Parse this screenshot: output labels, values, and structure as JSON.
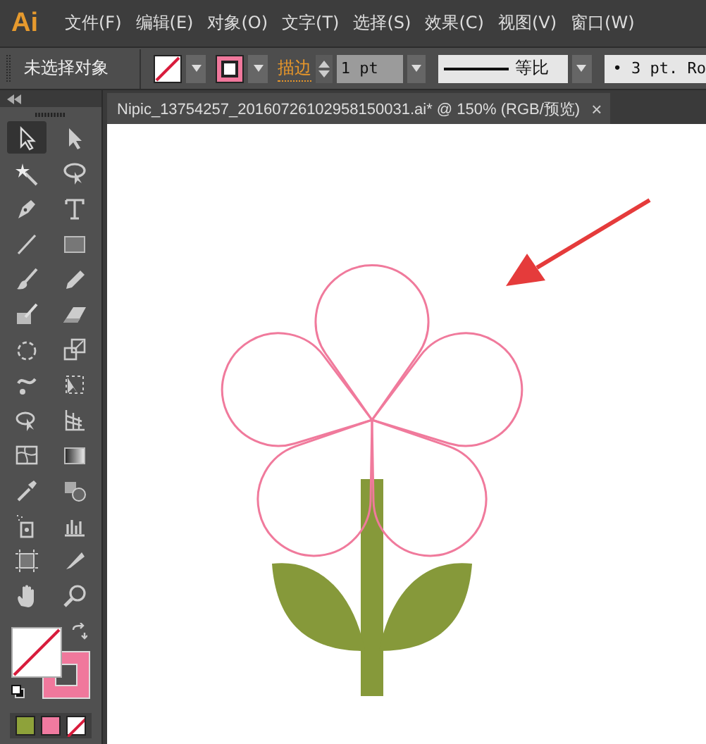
{
  "app_logo": "Ai",
  "menu": [
    "文件(F)",
    "编辑(E)",
    "对象(O)",
    "文字(T)",
    "选择(S)",
    "效果(C)",
    "视图(V)",
    "窗口(W)"
  ],
  "control_bar": {
    "selection_status": "未选择对象",
    "stroke_label": "描边",
    "stroke_weight": "1 pt",
    "profile": "等比",
    "brush": "•  3 pt. Ro"
  },
  "document_tab": {
    "title": "Nipic_13754257_20160726102958150031.ai*  @  150%  (RGB/预览)",
    "close": "×"
  },
  "tools": [
    {
      "kind": "selection",
      "selected": true
    },
    {
      "kind": "direct-selection",
      "selected": false
    },
    {
      "kind": "magic-wand",
      "selected": false
    },
    {
      "kind": "lasso",
      "selected": false
    },
    {
      "kind": "pen",
      "selected": false
    },
    {
      "kind": "type",
      "selected": false
    },
    {
      "kind": "line",
      "selected": false
    },
    {
      "kind": "rectangle",
      "selected": false
    },
    {
      "kind": "paintbrush",
      "selected": false
    },
    {
      "kind": "pencil",
      "selected": false
    },
    {
      "kind": "blob-brush",
      "selected": false
    },
    {
      "kind": "eraser",
      "selected": false
    },
    {
      "kind": "rotate",
      "selected": false
    },
    {
      "kind": "scale",
      "selected": false
    },
    {
      "kind": "warp",
      "selected": false
    },
    {
      "kind": "free-transform",
      "selected": false
    },
    {
      "kind": "shape-builder",
      "selected": false
    },
    {
      "kind": "perspective-grid",
      "selected": false
    },
    {
      "kind": "mesh",
      "selected": false
    },
    {
      "kind": "gradient",
      "selected": false
    },
    {
      "kind": "eyedropper",
      "selected": false
    },
    {
      "kind": "blend",
      "selected": false
    },
    {
      "kind": "symbol-sprayer",
      "selected": false
    },
    {
      "kind": "column-graph",
      "selected": false
    },
    {
      "kind": "artboard",
      "selected": false
    },
    {
      "kind": "slice",
      "selected": false
    },
    {
      "kind": "hand",
      "selected": false
    },
    {
      "kind": "zoom",
      "selected": false
    }
  ],
  "fill": {
    "kind": "none"
  },
  "stroke": {
    "kind": "color",
    "color": "#f0789c"
  },
  "color_modes": [
    {
      "kind": "color",
      "color": "#8ea23a"
    },
    {
      "kind": "gradient",
      "color": "#f07aa0"
    },
    {
      "kind": "none"
    }
  ]
}
